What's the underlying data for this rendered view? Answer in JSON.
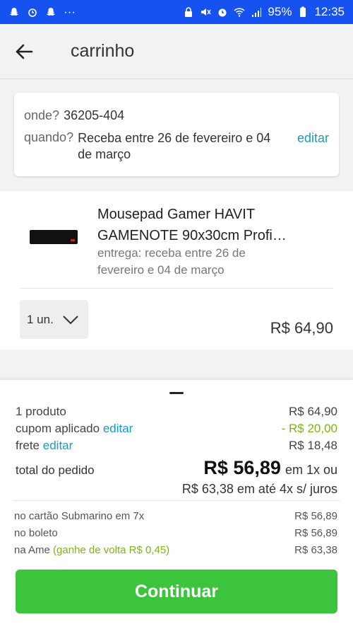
{
  "status_bar": {
    "battery": "95%",
    "time": "12:35"
  },
  "header": {
    "title": "carrinho"
  },
  "delivery": {
    "where_label": "onde?",
    "where_value": "36205-404",
    "when_label": "quando?",
    "when_value": "Receba entre 26 de fevereiro e 04 de março",
    "edit_label": "editar"
  },
  "item": {
    "name": "Mousepad Gamer HAVIT GAMENOTE 90x30cm Profi…",
    "delivery": "entrega: receba entre 26 de fevereiro e 04 de março",
    "quantity": "1 un.",
    "price": "R$ 64,90"
  },
  "summary": {
    "products_label": "1 produto",
    "products_value": "R$ 64,90",
    "coupon_label": "cupom aplicado",
    "coupon_edit": "editar",
    "coupon_value": "- R$ 20,00",
    "shipping_label": "frete",
    "shipping_edit": "editar",
    "shipping_value": "R$ 18,48",
    "total_label": "total do pedido",
    "total_value": "R$ 56,89",
    "total_suffix": "em 1x ou",
    "installments": "R$ 63,38 em até 4x s/ juros"
  },
  "payment_options": [
    {
      "label": "no cartão Submarino em 7x",
      "extra": "",
      "value": "R$ 56,89"
    },
    {
      "label": "no boleto",
      "extra": "",
      "value": "R$ 56,89"
    },
    {
      "label": "na Ame",
      "extra": "(ganhe de volta R$ 0,45)",
      "value": "R$ 63,38"
    }
  ],
  "cta_label": "Continuar",
  "colors": {
    "status_bar": "#1652f0",
    "link": "#1a9cb8",
    "green": "#7cb518",
    "cta": "#3cc43c"
  }
}
